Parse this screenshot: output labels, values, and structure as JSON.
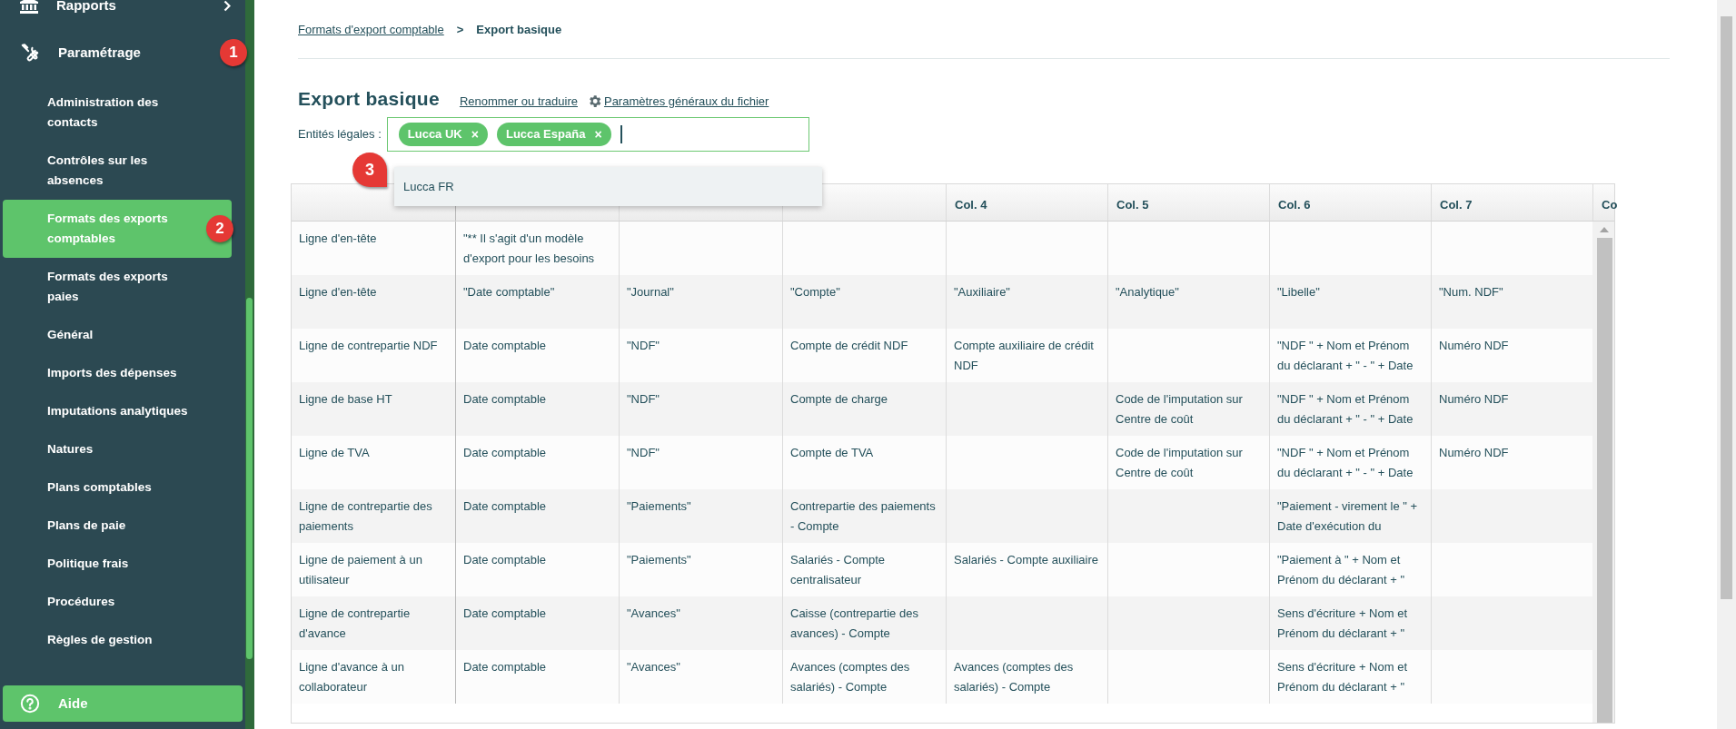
{
  "sidebar": {
    "items": [
      {
        "kind": "reports",
        "label": "Rapports",
        "selected": false,
        "expanded": false
      },
      {
        "kind": "settings",
        "label": "Paramétrage",
        "selected": false,
        "expanded": true,
        "badge": "1",
        "children": [
          {
            "kind": "link",
            "label": "Administration des contacts",
            "selected": false
          },
          {
            "kind": "link",
            "label": "Contrôles sur les absences",
            "selected": false
          },
          {
            "kind": "link",
            "label": "Formats des exports comptables",
            "selected": true,
            "badge": "2"
          },
          {
            "kind": "link",
            "label": "Formats des exports paies",
            "selected": false
          },
          {
            "kind": "link",
            "label": "Général",
            "selected": false
          },
          {
            "kind": "link",
            "label": "Imports des dépenses",
            "selected": false
          },
          {
            "kind": "link",
            "label": "Imputations analytiques",
            "selected": false
          },
          {
            "kind": "link",
            "label": "Natures",
            "selected": false
          },
          {
            "kind": "link",
            "label": "Plans comptables",
            "selected": false
          },
          {
            "kind": "link",
            "label": "Plans de paie",
            "selected": false
          },
          {
            "kind": "link",
            "label": "Politique frais",
            "selected": false
          },
          {
            "kind": "link",
            "label": "Procédures",
            "selected": false
          },
          {
            "kind": "link",
            "label": "Règles de gestion",
            "selected": false
          }
        ]
      }
    ],
    "help": {
      "label": "Aide"
    }
  },
  "breadcrumb": {
    "parent": "Formats d'export comptable",
    "separator": ">",
    "current": "Export basique"
  },
  "title": "Export basique",
  "links": [
    "Renommer ou traduire",
    "Paramètres généraux du fichier"
  ],
  "legal_entities": {
    "label": "Entités légales :",
    "tags": [
      "Lucca UK",
      "Lucca España"
    ],
    "remove": "×",
    "dropdown": {
      "options": [
        "Lucca FR"
      ],
      "badge": "3"
    }
  },
  "table": {
    "columns": [
      null,
      null,
      null,
      "Col. 4",
      "Col. 5",
      "Col. 6",
      "Col. 7",
      "Co"
    ],
    "rows": [
      {
        "label": "Ligne d'en-tête",
        "cells": [
          "\"** Il s'agit d'un modèle d'export pour les besoins",
          null,
          null,
          null,
          null,
          null,
          null
        ]
      },
      {
        "label": "Ligne d'en-tête",
        "cells": [
          "\"Date comptable\"",
          "\"Journal\"",
          "\"Compte\"",
          "\"Auxiliaire\"",
          "\"Analytique\"",
          "\"Libelle\"",
          "\"Num. NDF\""
        ]
      },
      {
        "label": "Ligne de contrepartie NDF",
        "cells": [
          "Date comptable",
          "\"NDF\"",
          "Compte de crédit NDF",
          "Compte auxiliaire de crédit NDF",
          null,
          "\"NDF \" + Nom et Prénom du déclarant + \" - \" + Date",
          "Numéro NDF"
        ]
      },
      {
        "label": "Ligne de base HT",
        "cells": [
          "Date comptable",
          "\"NDF\"",
          "Compte de charge",
          null,
          "Code de l'imputation sur Centre de coût",
          "\"NDF \" + Nom et Prénom du déclarant + \" - \" + Date",
          "Numéro NDF"
        ]
      },
      {
        "label": "Ligne de TVA",
        "cells": [
          "Date comptable",
          "\"NDF\"",
          "Compte de TVA",
          null,
          "Code de l'imputation sur Centre de coût",
          "\"NDF \" + Nom et Prénom du déclarant + \" - \" + Date",
          "Numéro NDF"
        ]
      },
      {
        "label": "Ligne de contrepartie des paiements",
        "cells": [
          "Date comptable",
          "\"Paiements\"",
          "Contrepartie des paiements - Compte",
          null,
          null,
          "\"Paiement - virement le \" + Date d'exécution du",
          null
        ]
      },
      {
        "label": "Ligne de paiement à un utilisateur",
        "cells": [
          "Date comptable",
          "\"Paiements\"",
          "Salariés - Compte centralisateur",
          "Salariés - Compte auxiliaire",
          null,
          "\"Paiement à \" + Nom et Prénom du déclarant + \"",
          null
        ]
      },
      {
        "label": "Ligne de contrepartie d'avance",
        "cells": [
          "Date comptable",
          "\"Avances\"",
          "Caisse (contrepartie des avances) - Compte",
          null,
          null,
          "Sens d'écriture + Nom et Prénom du déclarant + \"",
          null
        ]
      },
      {
        "label": "Ligne d'avance à un collaborateur",
        "cells": [
          "Date comptable",
          "\"Avances\"",
          "Avances (comptes des salariés) - Compte",
          "Avances (comptes des salariés) - Compte",
          null,
          "Sens d'écriture + Nom et Prénom du déclarant + \"",
          null
        ]
      }
    ]
  }
}
